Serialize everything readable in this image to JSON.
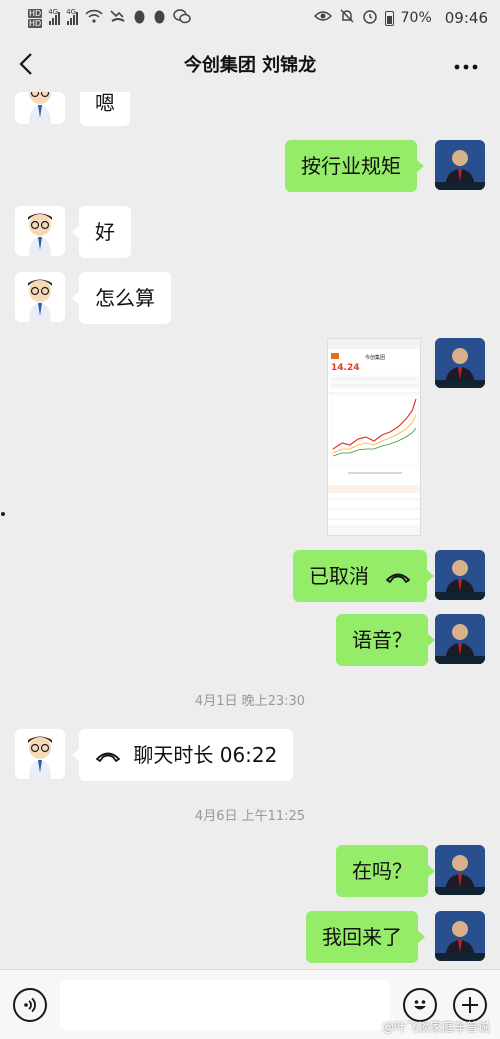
{
  "status_bar": {
    "hd1": "HD",
    "hd2": "HD",
    "net1": "4G",
    "net2": "4G",
    "battery": "70%",
    "time": "09:46"
  },
  "header": {
    "title": "今创集团 刘锦龙"
  },
  "messages": [
    {
      "side": "left",
      "text": "嗯",
      "partial": true
    },
    {
      "side": "right",
      "text": "按行业规矩"
    },
    {
      "side": "left",
      "text": "好"
    },
    {
      "side": "left",
      "text": "怎么算"
    },
    {
      "side": "right",
      "type": "image"
    },
    {
      "side": "right",
      "text": "已取消",
      "icon": "phone-hangup-icon"
    },
    {
      "side": "right",
      "text": "语音？"
    },
    {
      "type": "timestamp",
      "text": "4月1日 晚上23:30"
    },
    {
      "side": "left",
      "text": "聊天时长 06:22",
      "icon": "phone-hangup-icon"
    },
    {
      "type": "timestamp",
      "text": "4月6日 上午11:25"
    },
    {
      "side": "right",
      "text": "在吗？"
    },
    {
      "side": "right",
      "text": "我回来了"
    }
  ],
  "screenshot_thumb": {
    "title": "今创集团",
    "price": "14.24"
  },
  "input_bar": {
    "placeholder": ""
  },
  "watermark": "@叶飞谈家庭车普说",
  "colors": {
    "background": "#ededed",
    "bubble_self": "#95ec69",
    "bubble_other": "#ffffff",
    "timestamp": "#999999",
    "price_up": "#e3372b"
  }
}
